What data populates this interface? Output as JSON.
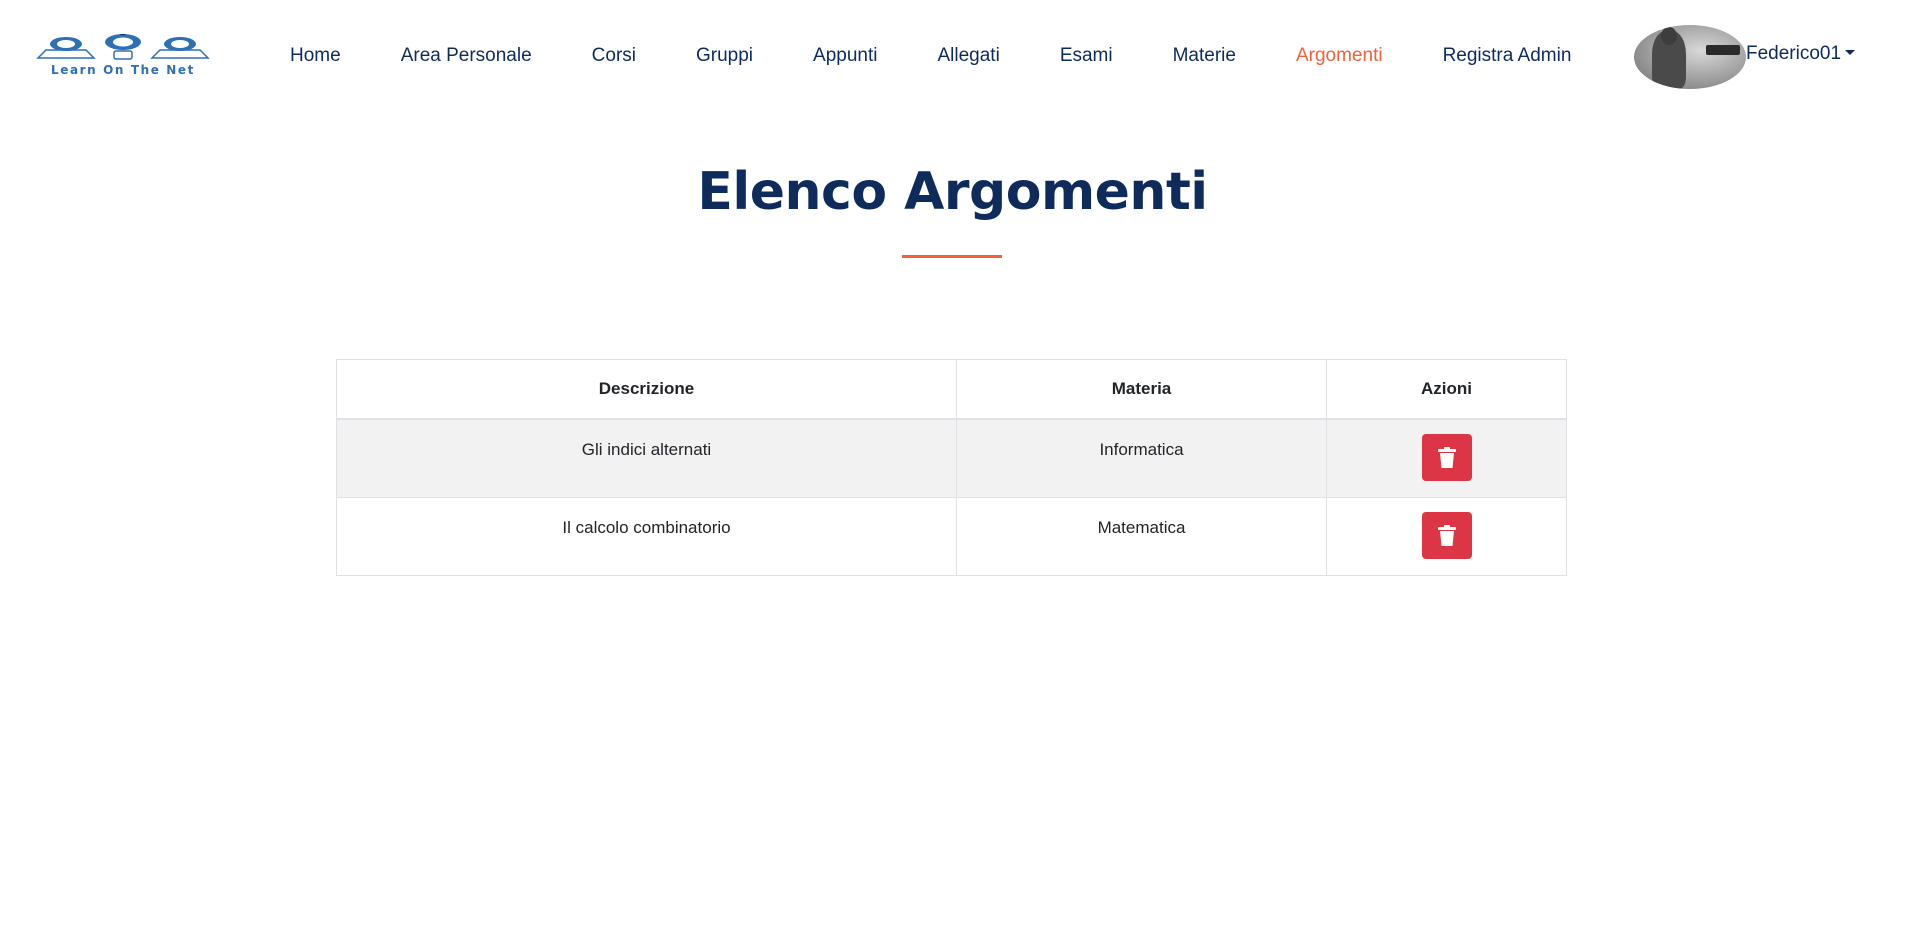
{
  "brand": {
    "logo_text": "Learn On The Net"
  },
  "nav": {
    "items": [
      {
        "label": "Home"
      },
      {
        "label": "Area Personale"
      },
      {
        "label": "Corsi"
      },
      {
        "label": "Gruppi"
      },
      {
        "label": "Appunti"
      },
      {
        "label": "Allegati"
      },
      {
        "label": "Esami"
      },
      {
        "label": "Materie"
      },
      {
        "label": "Argomenti",
        "active": true
      },
      {
        "label": "Registra Admin"
      }
    ]
  },
  "user": {
    "name": "Federico01"
  },
  "page": {
    "title": "Elenco Argomenti"
  },
  "table": {
    "headers": [
      "Descrizione",
      "Materia",
      "Azioni"
    ],
    "rows": [
      {
        "descrizione": "Gli indici alternati",
        "materia": "Informatica",
        "action_icon": "trash-icon"
      },
      {
        "descrizione": "Il calcolo combinatorio",
        "materia": "Matematica",
        "action_icon": "trash-icon"
      }
    ]
  },
  "colors": {
    "primary": "#0e2b5c",
    "accent": "#f2613b",
    "danger": "#dc3545",
    "stripe": "#f2f2f2"
  }
}
